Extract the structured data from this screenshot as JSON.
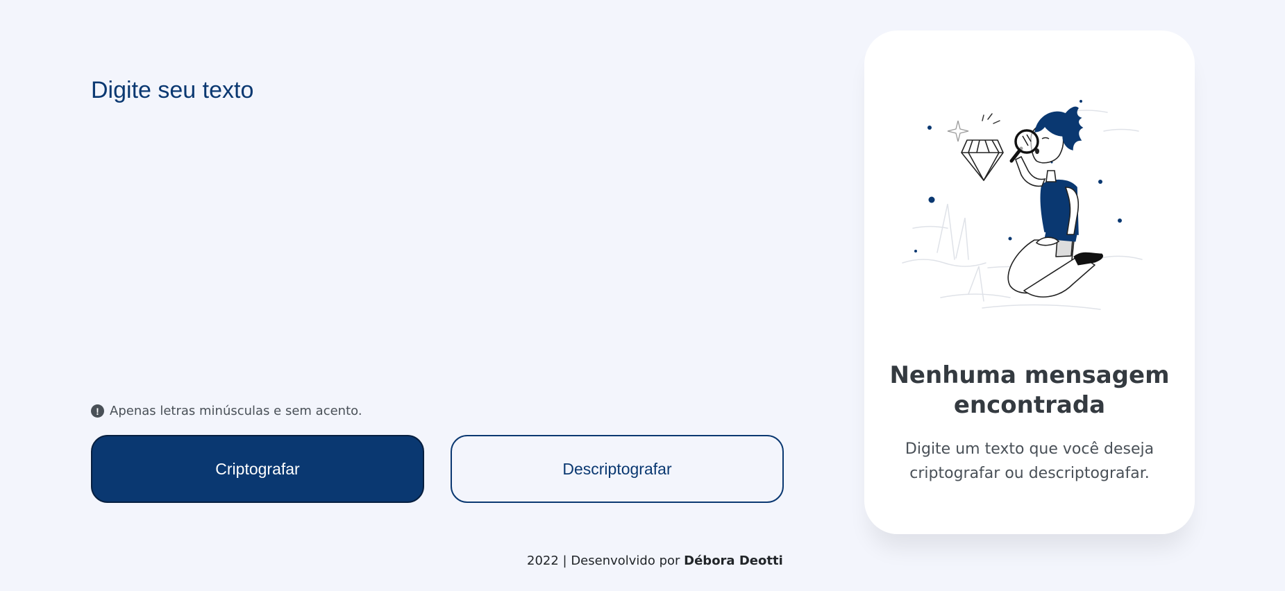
{
  "input": {
    "placeholder": "Digite seu texto"
  },
  "hint": {
    "icon": "exclamation-circle-icon",
    "text": "Apenas letras minúsculas e sem acento."
  },
  "buttons": {
    "encrypt_label": "Criptografar",
    "decrypt_label": "Descriptografar"
  },
  "footer": {
    "prefix": "2022 | Desenvolvido por ",
    "author": "Débora Deotti"
  },
  "result_card": {
    "illustration": "boy-with-magnifying-glass-illustration",
    "title": "Nenhuma mensagem encontrada",
    "subtitle": "Digite um texto que você deseja criptografar ou descriptografar."
  },
  "colors": {
    "background": "#f3f5fc",
    "primary": "#0a3871",
    "text_muted": "#495057",
    "card_title": "#343a40"
  }
}
